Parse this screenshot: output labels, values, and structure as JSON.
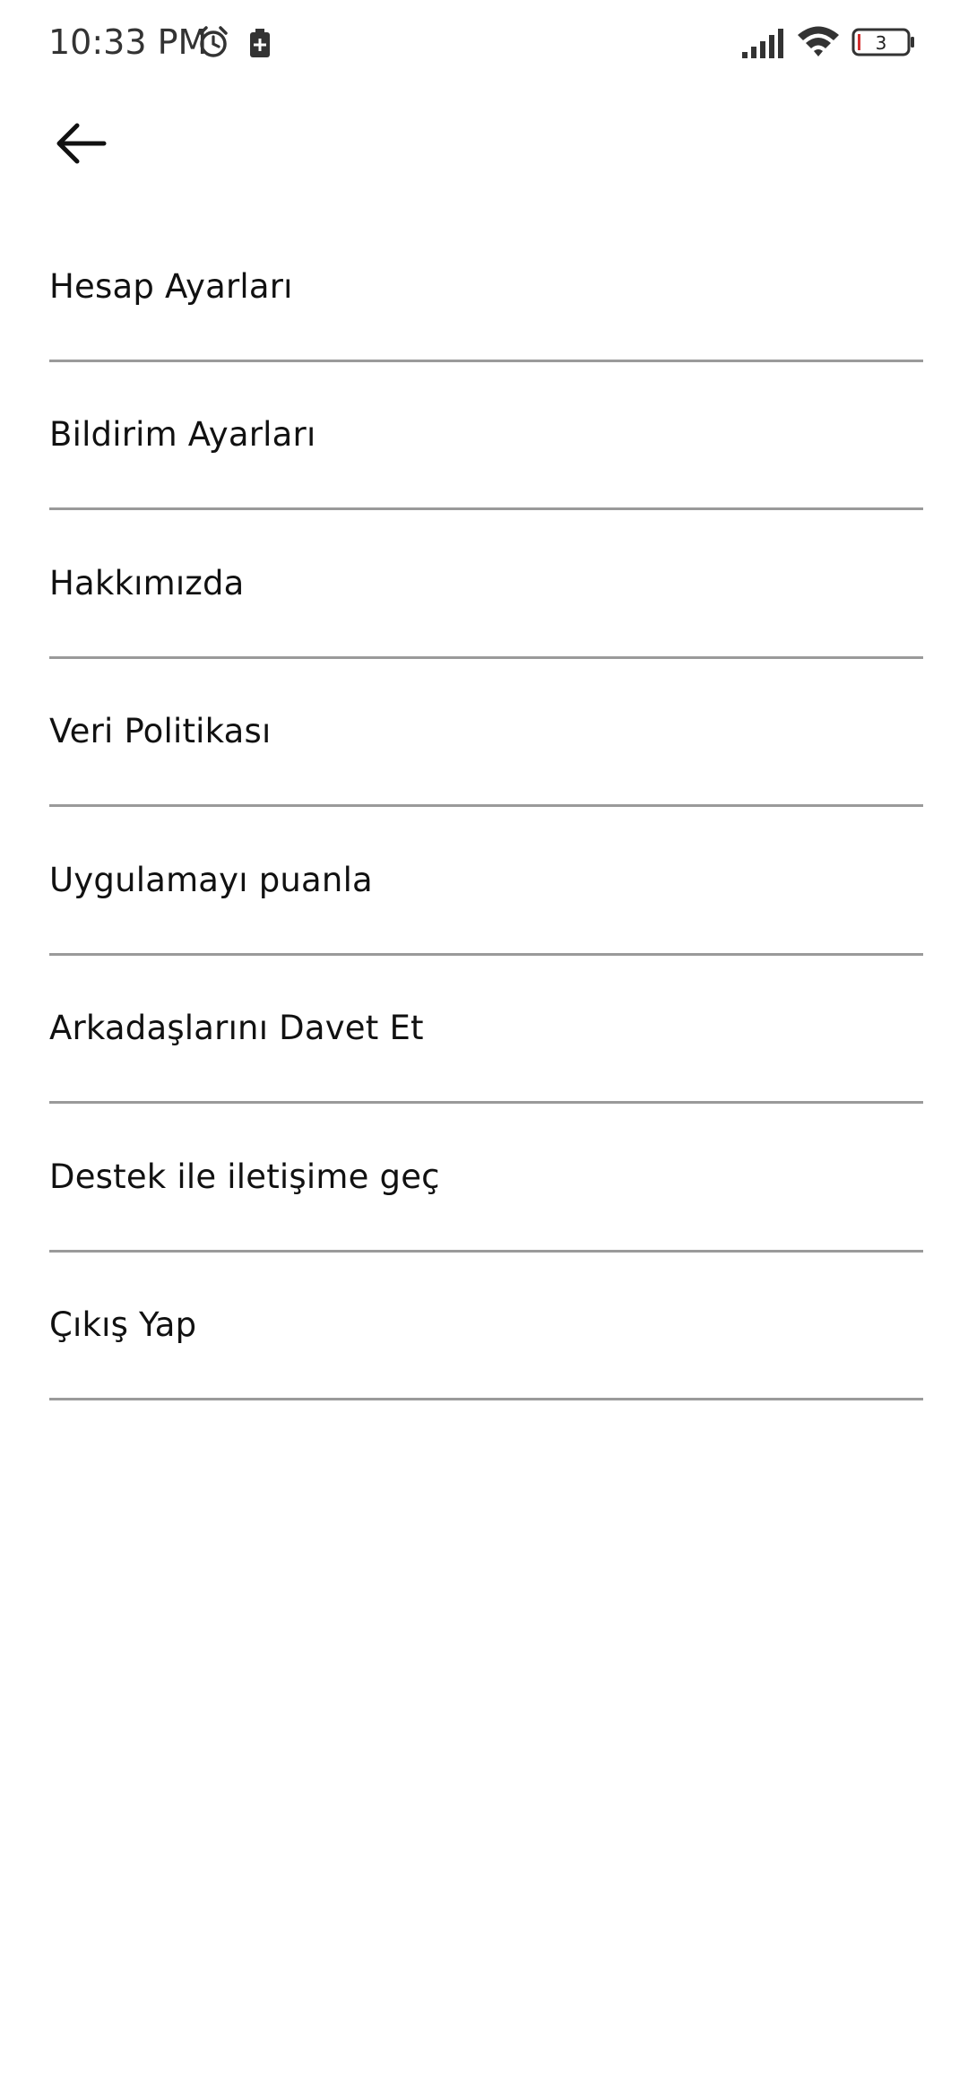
{
  "status_bar": {
    "time": "10:33 PM",
    "battery_level": "3",
    "icons": [
      "alarm-icon",
      "battery-saver-icon",
      "signal-icon",
      "wifi-icon",
      "battery-icon"
    ]
  },
  "header": {
    "back_icon": "back-arrow-icon"
  },
  "menu": {
    "items": [
      {
        "label": "Hesap Ayarları"
      },
      {
        "label": "Bildirim Ayarları"
      },
      {
        "label": "Hakkımızda"
      },
      {
        "label": "Veri Politikası"
      },
      {
        "label": "Uygulamayı puanla"
      },
      {
        "label": "Arkadaşlarını Davet Et"
      },
      {
        "label": "Destek ile iletişime geç"
      },
      {
        "label": "Çıkış Yap"
      }
    ]
  },
  "colors": {
    "background": "#ffffff",
    "text": "#111111",
    "divider": "#9a9a9a",
    "battery_low": "#d32f2f"
  }
}
